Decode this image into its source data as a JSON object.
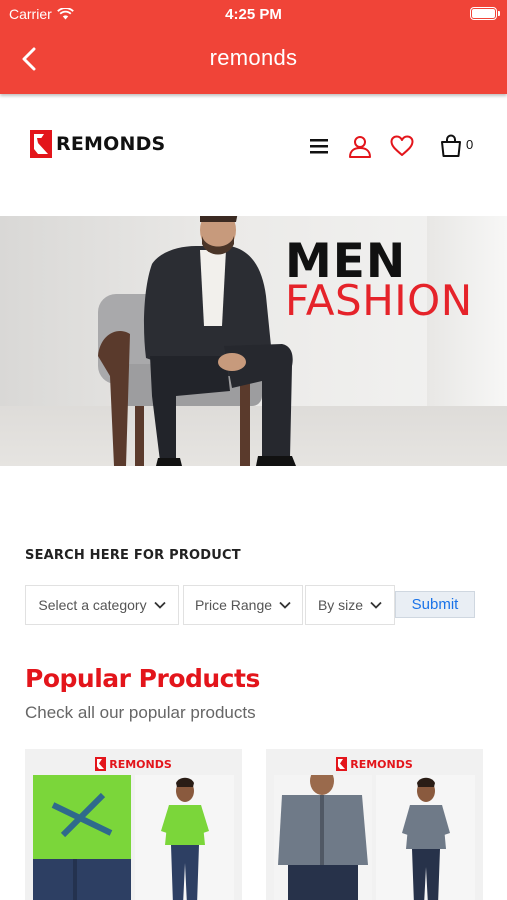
{
  "status": {
    "carrier": "Carrier",
    "time": "4:25 PM"
  },
  "nav": {
    "title": "remonds",
    "back_icon": "chevron-left-icon"
  },
  "header": {
    "brand": "REMONDS",
    "icons": [
      "menu-icon",
      "user-icon",
      "heart-icon",
      "cart-icon"
    ],
    "cart_count": "0"
  },
  "banner": {
    "line1": "MEN",
    "line2": "FASHION"
  },
  "search": {
    "title": "SEARCH HERE FOR PRODUCT",
    "category": "Select a category",
    "price": "Price Range",
    "size": "By size",
    "submit": "Submit"
  },
  "popular": {
    "title": "Popular Products",
    "subtitle": "Check all our popular products",
    "products": [
      {
        "brand": "REMONDS",
        "shirt_color": "#7bd63a"
      },
      {
        "brand": "REMONDS",
        "shirt_color": "#6f7a88"
      }
    ]
  },
  "colors": {
    "accent": "#f04438",
    "brand_red": "#e3151b",
    "link_blue": "#1a73e8"
  }
}
